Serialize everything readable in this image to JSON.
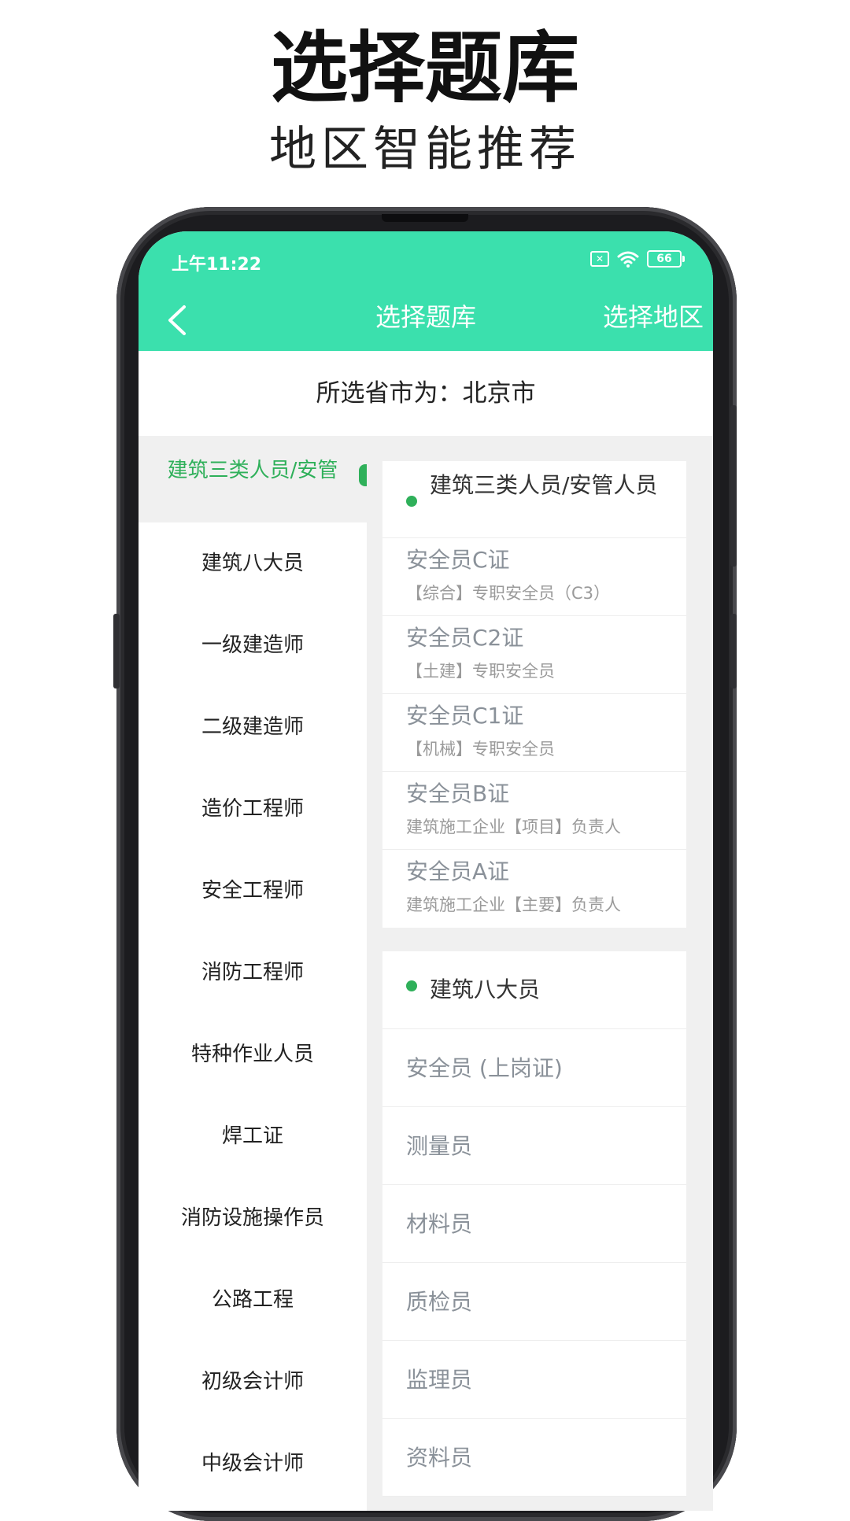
{
  "promo": {
    "title": "选择题库",
    "subtitle": "地区智能推荐"
  },
  "status_bar": {
    "time": "上午11:22",
    "battery": "66"
  },
  "nav": {
    "title": "选择题库",
    "action": "选择地区"
  },
  "region": {
    "text": "所选省市为：北京市"
  },
  "sidebar": {
    "items": [
      {
        "label": "建筑三类人员/安管",
        "active": true
      },
      {
        "label": "建筑八大员"
      },
      {
        "label": "一级建造师"
      },
      {
        "label": "二级建造师"
      },
      {
        "label": "造价工程师"
      },
      {
        "label": "安全工程师"
      },
      {
        "label": "消防工程师"
      },
      {
        "label": "特种作业人员"
      },
      {
        "label": "焊工证"
      },
      {
        "label": "消防设施操作员"
      },
      {
        "label": "公路工程"
      },
      {
        "label": "初级会计师"
      },
      {
        "label": "中级会计师"
      }
    ]
  },
  "groups": [
    {
      "title": "建筑三类人员/安管人员",
      "items": [
        {
          "name": "安全员C证",
          "desc": "【综合】专职安全员（C3）"
        },
        {
          "name": "安全员C2证",
          "desc": "【土建】专职安全员"
        },
        {
          "name": "安全员C1证",
          "desc": "【机械】专职安全员"
        },
        {
          "name": "安全员B证",
          "desc": "建筑施工企业【项目】负责人"
        },
        {
          "name": "安全员A证",
          "desc": "建筑施工企业【主要】负责人"
        }
      ]
    },
    {
      "title": "建筑八大员",
      "items": [
        {
          "name": "安全员 (上岗证)"
        },
        {
          "name": "测量员"
        },
        {
          "name": "材料员"
        },
        {
          "name": "质检员"
        },
        {
          "name": "监理员"
        },
        {
          "name": "资料员"
        }
      ]
    }
  ],
  "colors": {
    "accent_header": "#3be0ad",
    "accent_selected": "#2fb05a"
  },
  "icons": {
    "back": "chevron-left-icon",
    "sim": "sim-icon",
    "wifi": "wifi-icon",
    "battery": "battery-icon",
    "bullet": "bullet-icon"
  }
}
